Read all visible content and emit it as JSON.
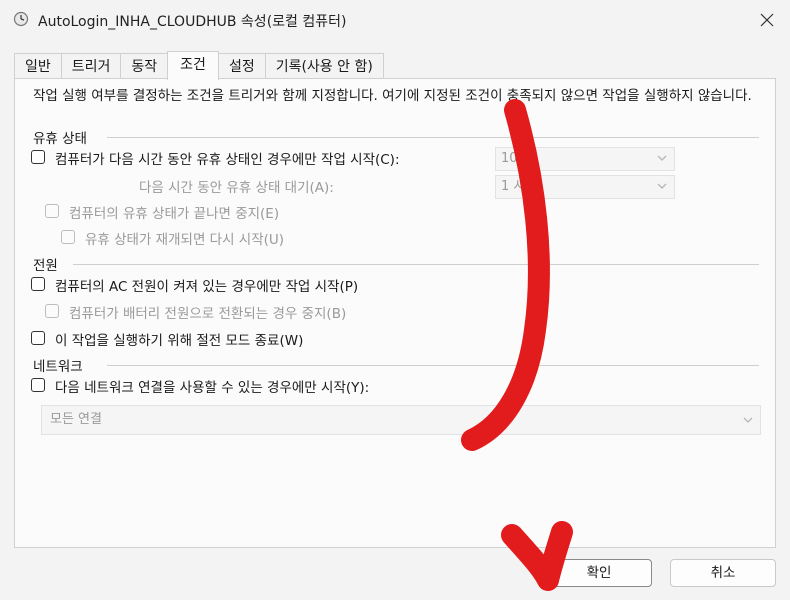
{
  "window": {
    "title": "AutoLogin_INHA_CLOUDHUB 속성(로컬 컴퓨터)"
  },
  "tabs": [
    {
      "label": "일반"
    },
    {
      "label": "트리거"
    },
    {
      "label": "동작"
    },
    {
      "label": "조건",
      "active": true
    },
    {
      "label": "설정"
    },
    {
      "label": "기록(사용 안 함)"
    }
  ],
  "conditions": {
    "description": "작업 실행 여부를 결정하는 조건을 트리거와 함께 지정합니다. 여기에 지정된 조건이 충족되지 않으면 작업을 실행하지 않습니다.",
    "idle": {
      "section_label": "유휴 상태",
      "start_if_idle": "컴퓨터가 다음 시간 동안 유휴 상태인 경우에만 작업 시작(C):",
      "idle_duration_value": "10",
      "wait_label": "다음 시간 동안 유휴 상태 대기(A):",
      "wait_value": "1 시",
      "stop_if_not_idle": "컴퓨터의 유휴 상태가 끝나면 중지(E)",
      "restart_if_idle": "유휴 상태가 재개되면 다시 시작(U)"
    },
    "power": {
      "section_label": "전원",
      "ac_only": "컴퓨터의 AC 전원이 켜져 있는 경우에만 작업 시작(P)",
      "stop_on_battery": "컴퓨터가 배터리 전원으로 전환되는 경우 중지(B)",
      "wake_to_run": "이 작업을 실행하기 위해 절전 모드 종료(W)"
    },
    "network": {
      "section_label": "네트워크",
      "start_if_network": "다음 네트워크 연결을 사용할 수 있는 경우에만 시작(Y):",
      "connection_value": "모든 연결"
    }
  },
  "buttons": {
    "ok": "확인",
    "cancel": "취소"
  },
  "colors": {
    "annotation_red": "#e21c1c",
    "disabled_text": "#9a9a9a"
  }
}
